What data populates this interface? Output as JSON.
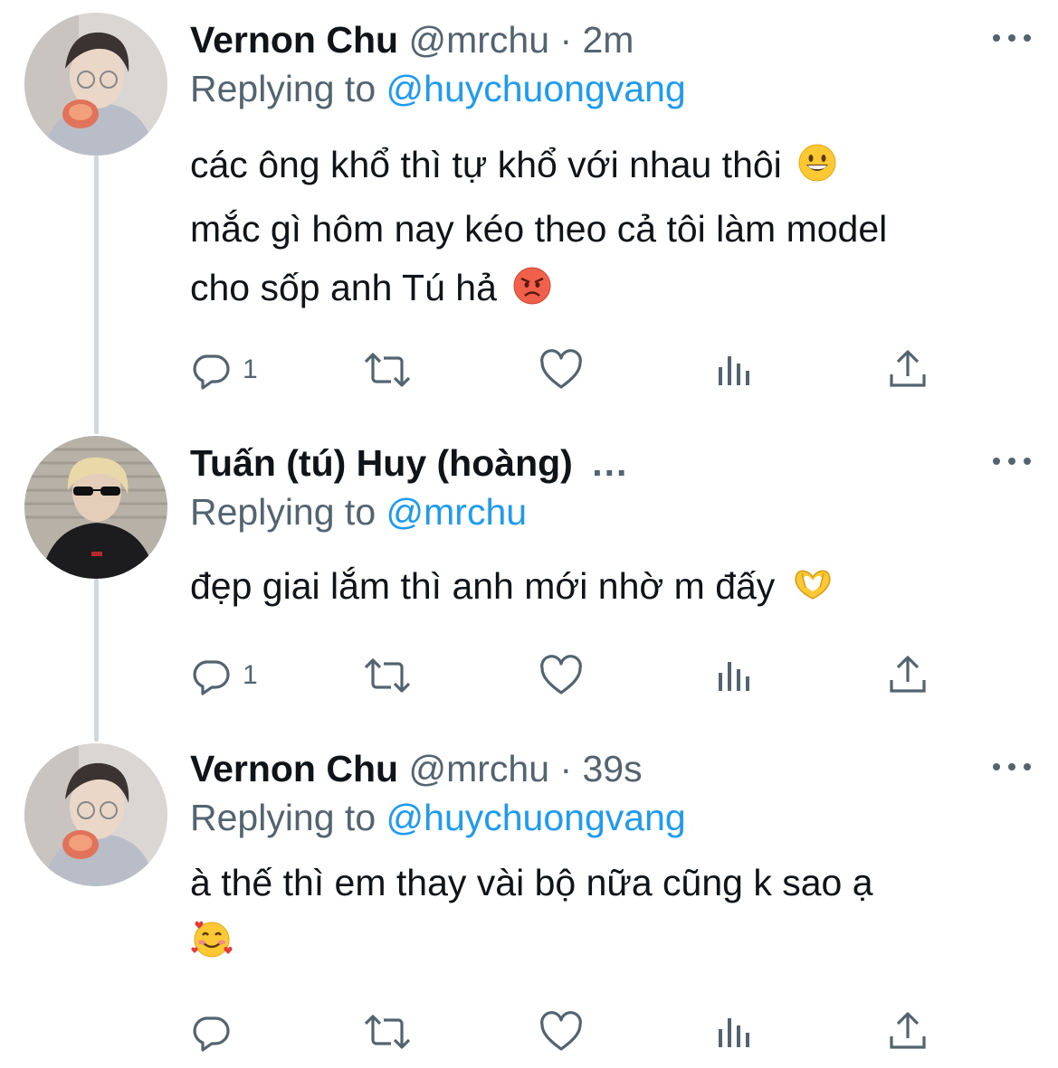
{
  "tweets": [
    {
      "name": "Vernon Chu",
      "handle": "@mrchu",
      "separator": "·",
      "time": "2m",
      "replying_label": "Replying to",
      "replying_mention": "@huychuongvang",
      "text_lines": [
        "các ông khổ thì tự khổ với nhau thôi",
        "mắc gì hôm nay kéo theo cả tôi làm model",
        "cho sốp anh Tú hả"
      ],
      "emojis": [
        "grinning-face",
        "pouting-face"
      ],
      "reply_count": "1"
    },
    {
      "name": "Tuấn (tú) Huy (hoàng)",
      "name_ellipsis": "...",
      "replying_label": "Replying to",
      "replying_mention": "@mrchu",
      "text_lines": [
        "đẹp giai lắm thì anh mới nhờ m đấy"
      ],
      "emojis": [
        "heart-hands"
      ],
      "reply_count": "1"
    },
    {
      "name": "Vernon Chu",
      "handle": "@mrchu",
      "separator": "·",
      "time": "39s",
      "replying_label": "Replying to",
      "replying_mention": "@huychuongvang",
      "text_lines": [
        "à thế thì em thay vài bộ nữa cũng k sao ạ"
      ],
      "emojis": [
        "smiling-face-with-hearts"
      ],
      "reply_count": ""
    }
  ],
  "colors": {
    "text": "#0f1419",
    "secondary": "#536471",
    "mention": "#1d9bf0",
    "thread_line": "#cfd9de"
  },
  "icons": [
    "reply-icon",
    "retweet-icon",
    "like-icon",
    "analytics-icon",
    "share-icon",
    "more-icon"
  ]
}
